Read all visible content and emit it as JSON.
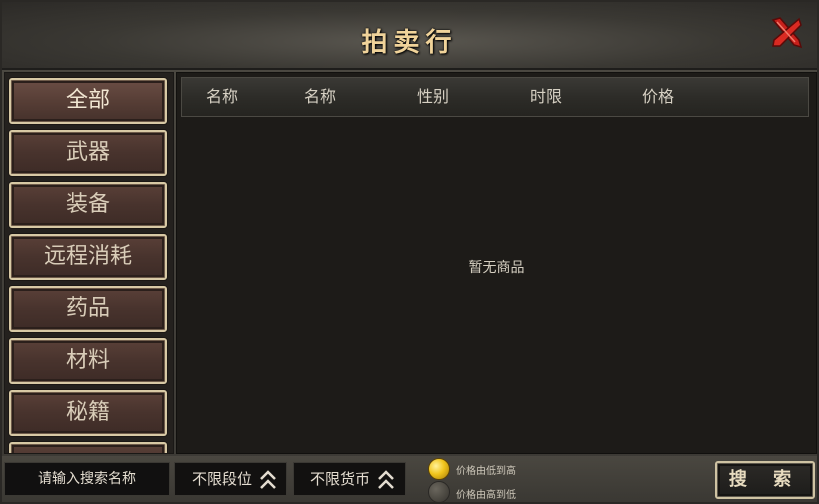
{
  "window": {
    "title": "拍卖行"
  },
  "sidebar": {
    "categories": [
      {
        "label": "全部",
        "active": true
      },
      {
        "label": "武器"
      },
      {
        "label": "装备"
      },
      {
        "label": "远程消耗"
      },
      {
        "label": "药品"
      },
      {
        "label": "材料"
      },
      {
        "label": "秘籍"
      }
    ]
  },
  "table": {
    "columns": [
      "名称",
      "名称",
      "性别",
      "时限",
      "价格"
    ],
    "empty_message": "暂无商品"
  },
  "bottom": {
    "search_placeholder": "请输入搜索名称",
    "filter_level": "不限段位",
    "filter_currency": "不限货币",
    "sort_low_high": "价格由低到高",
    "sort_high_low": "价格由高到低",
    "search_button": "搜 索"
  },
  "colors": {
    "title_gold": "#f0d39a",
    "sort_selected": "#f1c51c",
    "close_red": "#c8201b"
  },
  "icons": {
    "close": "close-x-icon",
    "filter_toggle": "double-chevron-up-icon",
    "radio_selected": "gold-coin-radio-icon",
    "radio_unselected": "grey-coin-radio-icon"
  }
}
